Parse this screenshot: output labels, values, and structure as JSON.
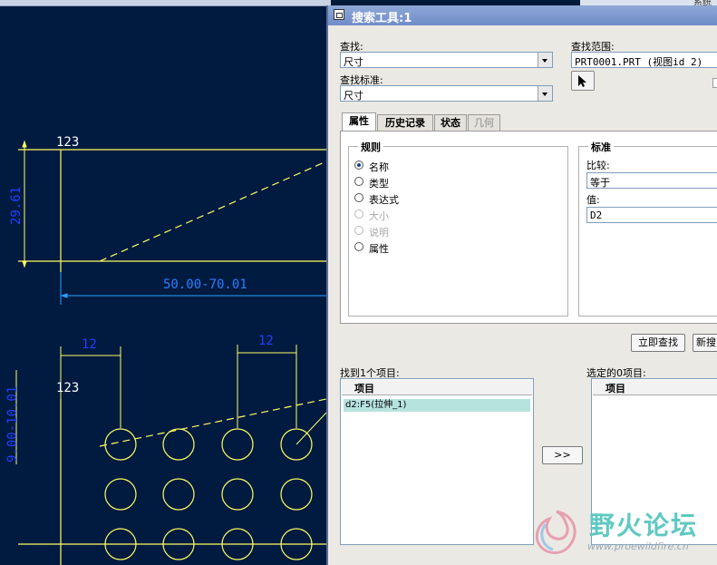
{
  "cad": {
    "dims": {
      "note_top": "123",
      "vertical_top": "29.61",
      "horizontal": "50.00-70.01",
      "spacing_left": "12",
      "spacing_right": "12",
      "note_bottom": "123",
      "vertical_bottom": "9.00-10.01"
    }
  },
  "toolbar_right": {
    "label": "系统"
  },
  "dialog": {
    "title": "搜索工具:1",
    "find_label": "查找:",
    "find_value": "尺寸",
    "scope_label": "查找范围:",
    "scope_value": "PRT0001.PRT (视图id 2)",
    "criteria_label": "查找标准:",
    "criteria_value": "尺寸",
    "tabs": [
      {
        "label": "属性",
        "active": true,
        "enabled": true
      },
      {
        "label": "历史记录",
        "active": false,
        "enabled": true
      },
      {
        "label": "状态",
        "active": false,
        "enabled": true
      },
      {
        "label": "几何",
        "active": false,
        "enabled": false
      }
    ],
    "rules": {
      "title": "规则",
      "options": [
        {
          "label": "名称",
          "selected": true,
          "enabled": true
        },
        {
          "label": "类型",
          "selected": false,
          "enabled": true
        },
        {
          "label": "表达式",
          "selected": false,
          "enabled": true
        },
        {
          "label": "大小",
          "selected": false,
          "enabled": false
        },
        {
          "label": "说明",
          "selected": false,
          "enabled": false
        },
        {
          "label": "属性",
          "selected": false,
          "enabled": true
        }
      ]
    },
    "criteria": {
      "title": "标准",
      "compare_label": "比较:",
      "compare_value": "等于",
      "value_label": "值:",
      "value_value": "D2"
    },
    "find_now_button": "立即查找",
    "new_search_button": "新搜",
    "found_label": "找到1个项目:",
    "found_header": "项目",
    "found_items": [
      "d2:F5(拉伸_1)"
    ],
    "transfer_button": ">>",
    "selected_label": "选定的0项目:",
    "selected_header": "项目"
  },
  "watermark": {
    "title": "野火论坛",
    "url": "www.proewildfire.cn"
  },
  "colors": {
    "cad_bg": "#001a40",
    "dim_blue": "#2040ff",
    "geom_yellow": "#ffff60",
    "title_bar": "#7f9bd0",
    "highlight": "#b7e3df"
  }
}
